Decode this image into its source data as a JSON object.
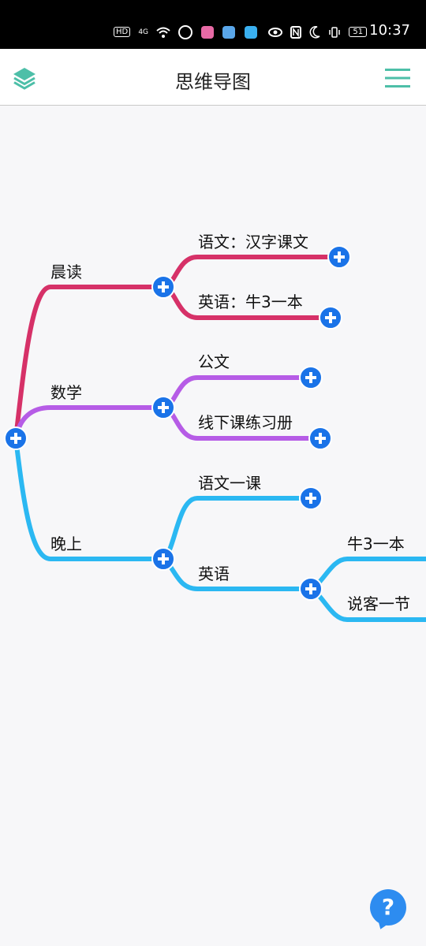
{
  "status_bar": {
    "time": "10:37",
    "network": "4G",
    "hd_badge": "HD",
    "battery_level": "51",
    "icons": [
      "hd-icon",
      "signal-icon",
      "wifi-icon",
      "k-app-icon",
      "app-icon-1",
      "app-icon-2",
      "app-icon-3",
      "eye-icon",
      "nfc-icon",
      "moon-icon",
      "vibrate-icon",
      "battery-icon"
    ]
  },
  "app_bar": {
    "title": "思维导图",
    "left_icon": "layers-icon",
    "right_icon": "menu-icon"
  },
  "mindmap": {
    "branches": [
      {
        "label": "晨读",
        "color": "#d63168",
        "children": [
          {
            "label": "语文：汉字课文"
          },
          {
            "label": "英语：牛3一本"
          }
        ]
      },
      {
        "label": "数学",
        "color": "#b65ce6",
        "children": [
          {
            "label": "公文"
          },
          {
            "label": "线下课练习册"
          }
        ]
      },
      {
        "label": "晚上",
        "color": "#2bb8f2",
        "children": [
          {
            "label": "语文一课"
          },
          {
            "label": "英语",
            "children": [
              {
                "label": "牛3一本"
              },
              {
                "label": "说客一节"
              }
            ]
          }
        ]
      }
    ]
  },
  "help_button": {
    "label": "?",
    "color": "#2d8cf0"
  }
}
